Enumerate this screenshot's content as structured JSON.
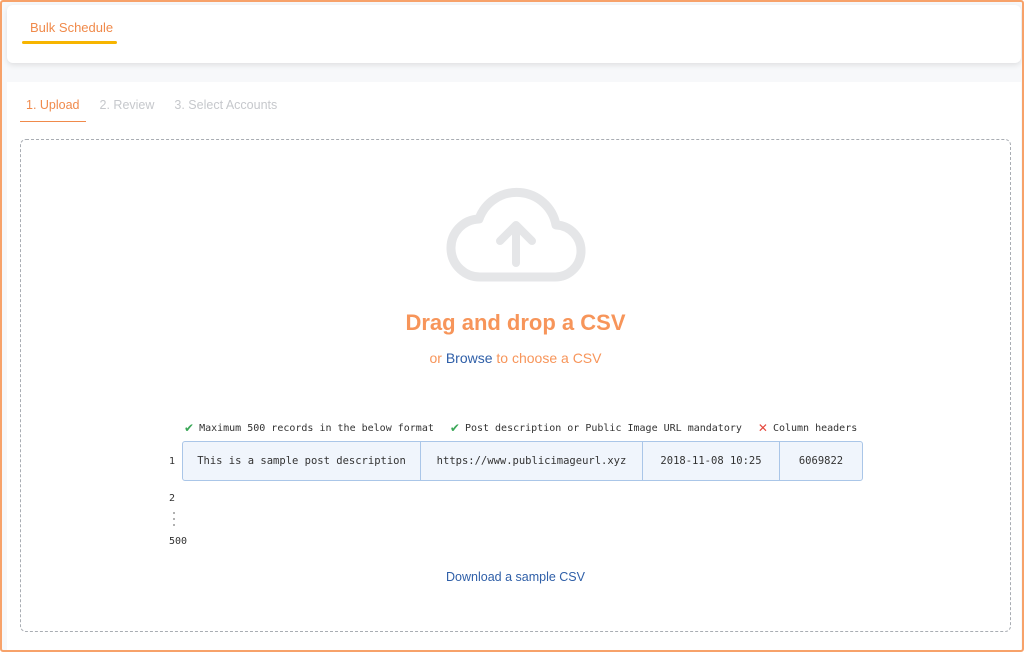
{
  "header": {
    "tab_label": "Bulk Schedule",
    "accent_color": "#f08a4b",
    "underline_color": "#f7b500"
  },
  "steps": [
    {
      "label": "1. Upload",
      "active": true
    },
    {
      "label": "2. Review",
      "active": false
    },
    {
      "label": "3. Select Accounts",
      "active": false
    }
  ],
  "drop_zone": {
    "icon": "cloud-upload-icon",
    "title": "Drag and drop a CSV",
    "sub_prefix": "or",
    "browse_label": "Browse",
    "sub_suffix": "to choose a CSV"
  },
  "rules": [
    {
      "status": "ok",
      "icon": "check-icon",
      "text": "Maximum 500 records in the below format"
    },
    {
      "status": "ok",
      "icon": "check-icon",
      "text": "Post description or Public Image URL mandatory"
    },
    {
      "status": "no",
      "icon": "cross-icon",
      "text": "Column headers"
    }
  ],
  "sample": {
    "row_numbers": [
      "1",
      "2",
      "500"
    ],
    "cells": [
      "This is a sample post description",
      "https://www.publicimageurl.xyz",
      "2018-11-08 10:25",
      "6069822"
    ]
  },
  "download_label": "Download a sample CSV"
}
